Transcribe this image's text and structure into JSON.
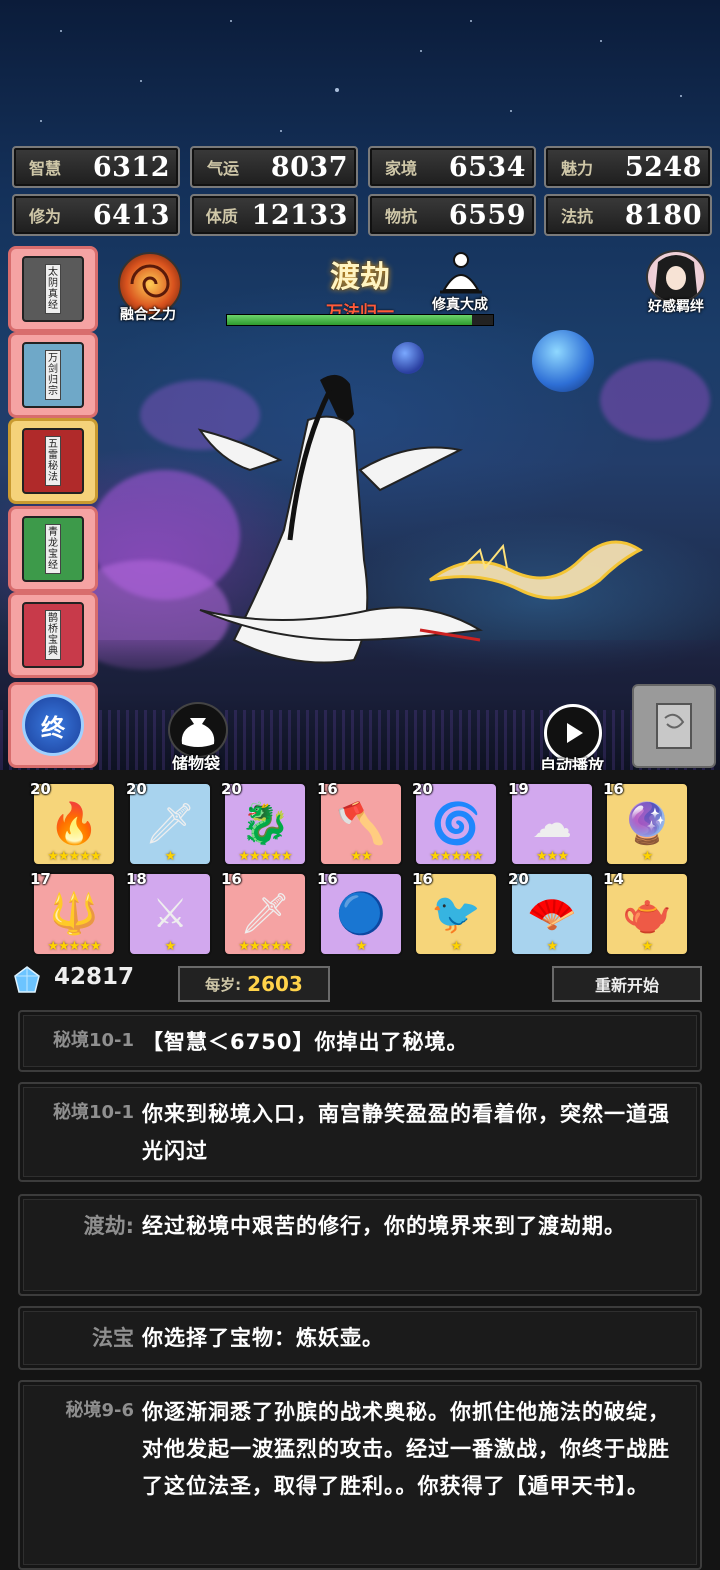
{
  "stats": [
    {
      "label": "智慧",
      "value": "6312"
    },
    {
      "label": "气运",
      "value": "8037"
    },
    {
      "label": "家境",
      "value": "6534"
    },
    {
      "label": "魅力",
      "value": "5248"
    },
    {
      "label": "修为",
      "value": "6413"
    },
    {
      "label": "体质",
      "value": "12133"
    },
    {
      "label": "物抗",
      "value": "6559"
    },
    {
      "label": "法抗",
      "value": "8180"
    }
  ],
  "books": [
    {
      "title": "太阴真经",
      "color": "gray"
    },
    {
      "title": "万剑归宗",
      "color": "blue"
    },
    {
      "title": "五雷秘法",
      "color": "red"
    },
    {
      "title": "青龙宝经",
      "color": "green"
    },
    {
      "title": "鹊桥宝典",
      "color": "red"
    }
  ],
  "end_button_label": "终",
  "realm": {
    "name": "渡劫",
    "subtitle": "万法归一",
    "progress": 0.92
  },
  "fusion_label": "融合之力",
  "cultivation_label": "修真大成",
  "affinity_label": "好感羁绊",
  "bag_label": "储物袋",
  "autoplay_label": "自动播放",
  "items": [
    {
      "level": "20",
      "rarity": "gold",
      "stars": 5,
      "icon": "flame-ring-icon",
      "glyph": "🔥"
    },
    {
      "level": "20",
      "rarity": "blue",
      "stars": 1,
      "icon": "wooden-sword-icon",
      "glyph": "🗡"
    },
    {
      "level": "20",
      "rarity": "purple",
      "stars": 5,
      "icon": "jade-claw-icon",
      "glyph": "🐉"
    },
    {
      "level": "16",
      "rarity": "red",
      "stars": 2,
      "icon": "battle-axe-icon",
      "glyph": "🪓"
    },
    {
      "level": "20",
      "rarity": "purple",
      "stars": 5,
      "icon": "dragon-ring-icon",
      "glyph": "🌀"
    },
    {
      "level": "19",
      "rarity": "purple",
      "stars": 3,
      "icon": "cloud-jade-icon",
      "glyph": "☁"
    },
    {
      "level": "16",
      "rarity": "gold",
      "stars": 1,
      "icon": "fire-pearl-icon",
      "glyph": "🔮"
    },
    {
      "level": "17",
      "rarity": "red",
      "stars": 5,
      "icon": "spear-icon",
      "glyph": "🔱"
    },
    {
      "level": "18",
      "rarity": "purple",
      "stars": 1,
      "icon": "spirit-sword-icon",
      "glyph": "⚔"
    },
    {
      "level": "16",
      "rarity": "red",
      "stars": 5,
      "icon": "great-sword-icon",
      "glyph": "🗡"
    },
    {
      "level": "16",
      "rarity": "purple",
      "stars": 1,
      "icon": "crystal-orb-icon",
      "glyph": "🔵"
    },
    {
      "level": "16",
      "rarity": "gold",
      "stars": 1,
      "icon": "phoenix-icon",
      "glyph": "🐦"
    },
    {
      "level": "20",
      "rarity": "blue",
      "stars": 1,
      "icon": "fan-icon",
      "glyph": "🪭"
    },
    {
      "level": "14",
      "rarity": "gold",
      "stars": 1,
      "icon": "demon-pot-icon",
      "glyph": "🫖"
    }
  ],
  "currency": "42817",
  "per_year_label": "每岁:",
  "per_year_value": "2603",
  "restart_label": "重新开始",
  "log": [
    {
      "tag": "秘境10-1",
      "text": "【智慧＜6750】你掉出了秘境。"
    },
    {
      "tag": "秘境10-1",
      "text": "你来到秘境入口，南宫静笑盈盈的看着你，突然一道强光闪过"
    },
    {
      "tag": "渡劫:",
      "text": "经过秘境中艰苦的修行，你的境界来到了渡劫期。"
    },
    {
      "tag": "法宝",
      "text": "你选择了宝物：炼妖壶。"
    },
    {
      "tag": "秘境9-6",
      "text": "你逐渐洞悉了孙膑的战术奥秘。你抓住他施法的破绽，对他发起一波猛烈的攻击。经过一番激战，你终于战胜了这位法圣，取得了胜利。。你获得了【遁甲天书】。"
    }
  ]
}
